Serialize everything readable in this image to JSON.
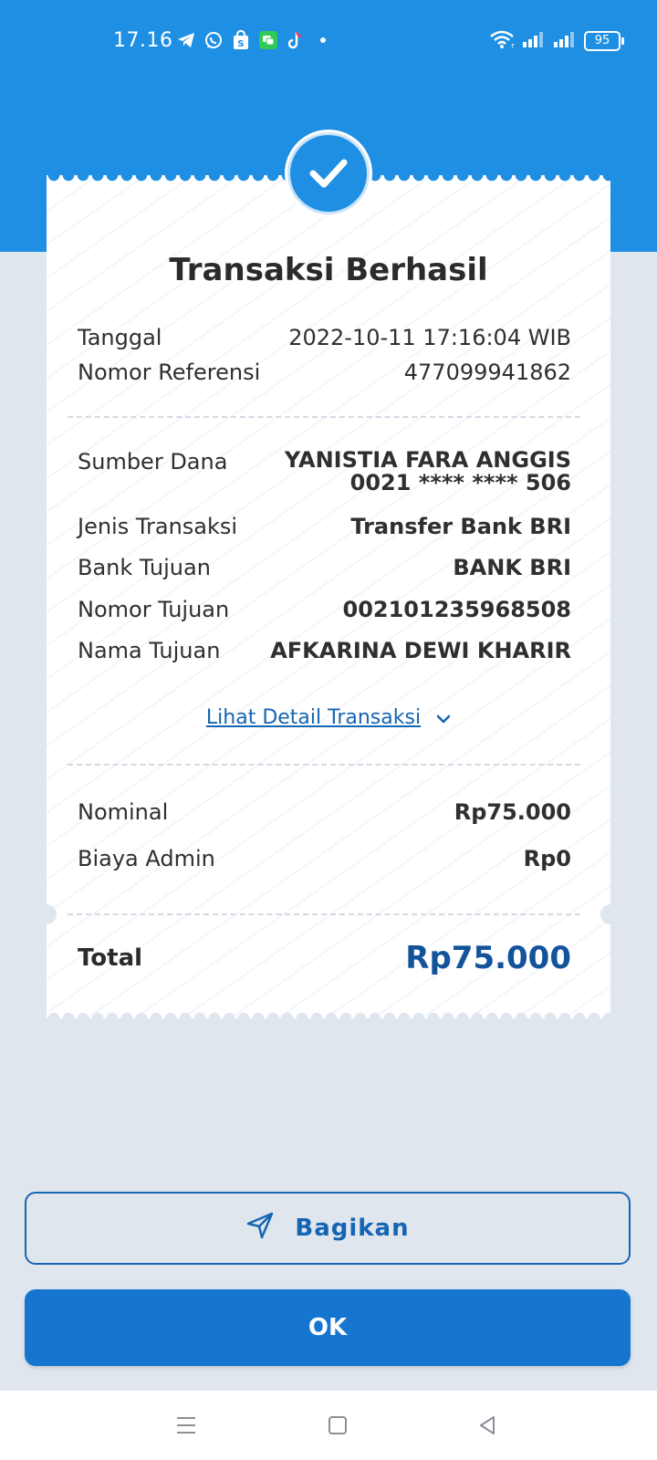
{
  "status_bar": {
    "time": "17.16",
    "battery": "95",
    "notification_icons": [
      "telegram-icon",
      "whatsapp-icon",
      "shopping-bag-icon",
      "chat-icon",
      "tiktok-icon",
      "dot-icon"
    ]
  },
  "receipt": {
    "title": "Transaksi Berhasil",
    "tanggal_label": "Tanggal",
    "tanggal_value": "2022-10-11 17:16:04 WIB",
    "referensi_label": "Nomor Referensi",
    "referensi_value": "477099941862",
    "sumber_dana_label": "Sumber Dana",
    "sumber_dana_name": "YANISTIA FARA ANGGIS",
    "sumber_dana_account": "0021 **** **** 506",
    "jenis_label": "Jenis Transaksi",
    "jenis_value": "Transfer Bank BRI",
    "bank_tujuan_label": "Bank Tujuan",
    "bank_tujuan_value": "BANK BRI",
    "nomor_tujuan_label": "Nomor Tujuan",
    "nomor_tujuan_value": "002101235968508",
    "nama_tujuan_label": "Nama Tujuan",
    "nama_tujuan_value": "AFKARINA DEWI KHARIR",
    "detail_link": "Lihat Detail Transaksi",
    "nominal_label": "Nominal",
    "nominal_value": "Rp75.000",
    "biaya_label": "Biaya Admin",
    "biaya_value": "Rp0",
    "total_label": "Total",
    "total_value": "Rp75.000"
  },
  "actions": {
    "share_label": "Bagikan",
    "ok_label": "OK"
  },
  "colors": {
    "header": "#1e8fe3",
    "accent": "#1565b3",
    "total": "#13539a",
    "background": "#dfe6ee"
  }
}
